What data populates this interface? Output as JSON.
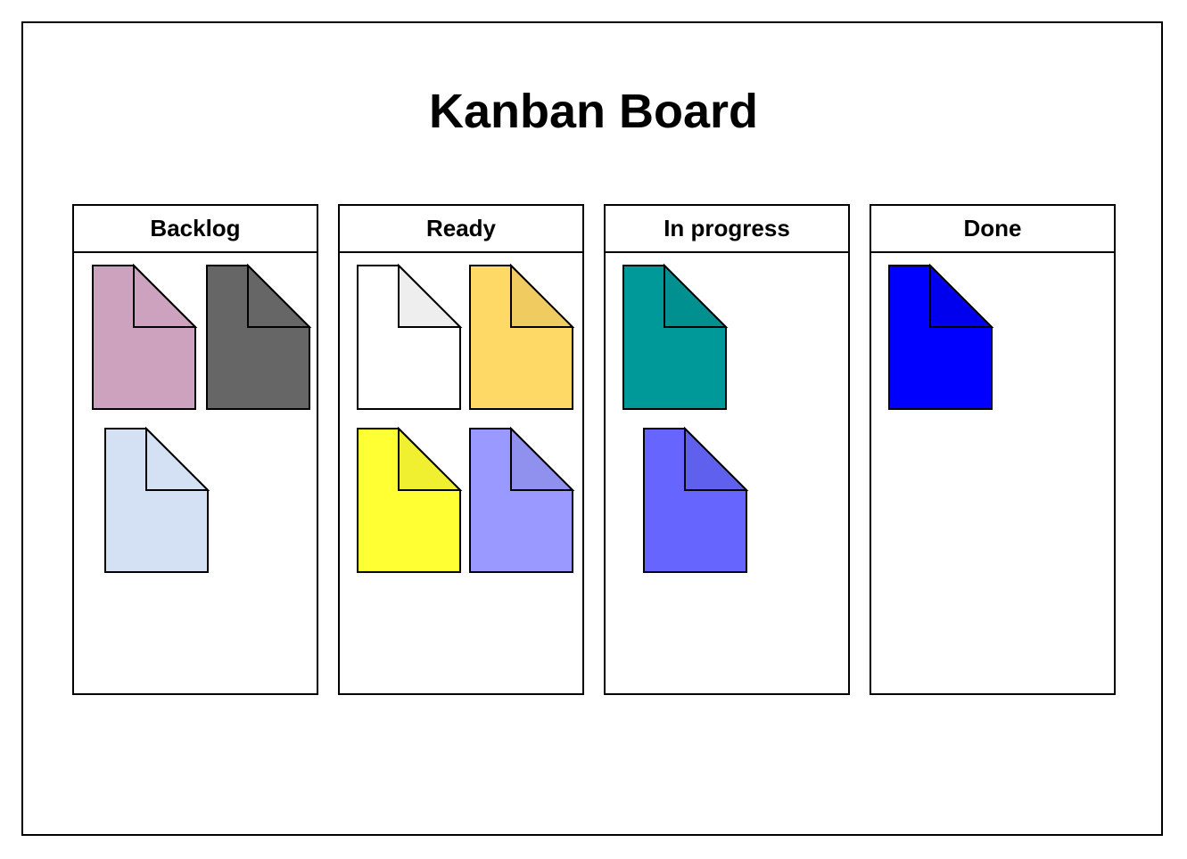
{
  "title": "Kanban Board",
  "columns": [
    {
      "label": "Backlog",
      "cards": [
        {
          "color": "#CDA2BE",
          "fold": "#CDA2BE"
        },
        {
          "color": "#666666",
          "fold": "#666666"
        },
        {
          "color": "#D4E1F5",
          "fold": "#D4E1F5"
        }
      ]
    },
    {
      "label": "Ready",
      "cards": [
        {
          "color": "#FFFFFF",
          "fold": "#EEEEEE"
        },
        {
          "color": "#FFD966",
          "fold": "#F0CC60"
        },
        {
          "color": "#FFFF33",
          "fold": "#F0F030"
        },
        {
          "color": "#9999FF",
          "fold": "#9090EE"
        }
      ]
    },
    {
      "label": "In progress",
      "cards": [
        {
          "color": "#009999",
          "fold": "#009090"
        },
        {
          "color": "#6666FF",
          "fold": "#6060EE"
        }
      ]
    },
    {
      "label": "Done",
      "cards": [
        {
          "color": "#0000FF",
          "fold": "#0000EE"
        }
      ]
    }
  ]
}
